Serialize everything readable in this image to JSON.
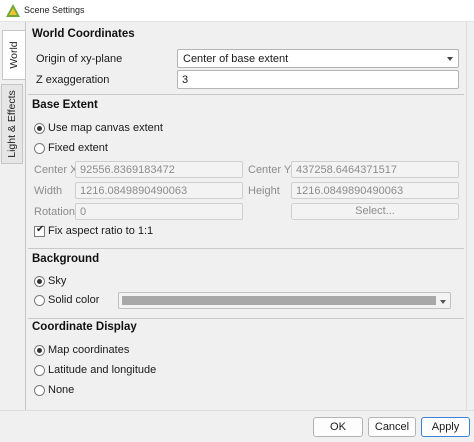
{
  "window": {
    "title": "Scene Settings"
  },
  "tabs": [
    {
      "label": "World"
    },
    {
      "label": "Light & Effects"
    }
  ],
  "world": {
    "title": "World Coordinates",
    "origin_label": "Origin of xy-plane",
    "origin_value": "Center of base extent",
    "z_label": "Z exaggeration",
    "z_value": "3"
  },
  "base_extent": {
    "title": "Base Extent",
    "use_map": "Use map canvas extent",
    "fixed": "Fixed extent",
    "center_x_label": "Center X",
    "center_x_value": "92556.8369183472",
    "center_y_label": "Center Y",
    "center_y_value": "437258.6464371517",
    "width_label": "Width",
    "width_value": "1216.0849890490063",
    "height_label": "Height",
    "height_value": "1216.0849890490063",
    "rotation_label": "Rotation",
    "rotation_value": "0",
    "select_label": "Select...",
    "fix_aspect": "Fix aspect ratio to 1:1"
  },
  "background": {
    "title": "Background",
    "sky": "Sky",
    "solid": "Solid color",
    "color": "#a8a8a8"
  },
  "coordinate_display": {
    "title": "Coordinate Display",
    "map": "Map coordinates",
    "latlon": "Latitude and longitude",
    "none": "None"
  },
  "footer": {
    "ok": "OK",
    "cancel": "Cancel",
    "apply": "Apply"
  },
  "colors": {
    "accent": "#3a82d6",
    "app_icon": "#6fa83a"
  }
}
